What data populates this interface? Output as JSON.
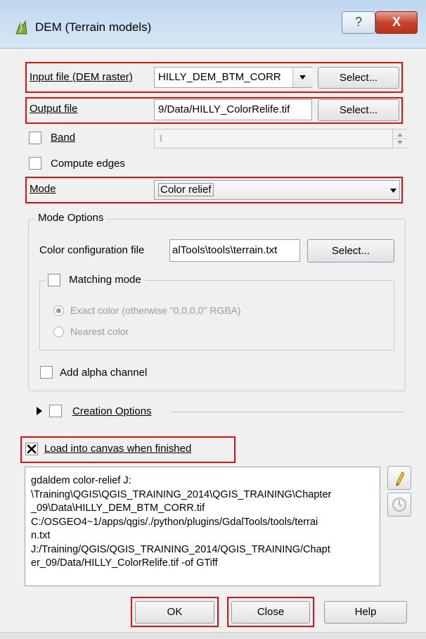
{
  "window": {
    "title": "DEM (Terrain models)",
    "help_glyph": "?",
    "close_glyph": "X"
  },
  "input": {
    "label": "Input file (DEM raster)",
    "value": "HILLY_DEM_BTM_CORR",
    "select_label": "Select..."
  },
  "output": {
    "label": "Output file",
    "value": "9/Data/HILLY_ColorRelife.tif",
    "select_label": "Select..."
  },
  "band": {
    "label": "Band",
    "value": "1",
    "checked": false
  },
  "compute_edges": {
    "label": "Compute edges",
    "checked": false
  },
  "mode": {
    "label": "Mode",
    "selected": "Color relief"
  },
  "mode_options": {
    "title": "Mode Options",
    "color_config_label": "Color configuration file",
    "color_config_value": "alTools\\tools\\terrain.txt",
    "select_label": "Select...",
    "matching_mode": {
      "label": "Matching mode",
      "checked": false,
      "exact_label": "Exact color (otherwise \"0,0,0,0\" RGBA)",
      "nearest_label": "Nearest color",
      "selected": "exact"
    },
    "alpha_label": "Add alpha channel"
  },
  "creation_options": {
    "label": "Creation Options",
    "expanded": false
  },
  "load_canvas": {
    "label": "Load into canvas when finished",
    "checked": true
  },
  "command": {
    "text": "gdaldem color-relief J:\n\\Training\\QGIS\\QGIS_TRAINING_2014\\QGIS_TRAINING\\Chapter\n_09\\Data\\HILLY_DEM_BTM_CORR.tif\nC:/OSGEO4~1/apps/qgis/./python/plugins/GdalTools/tools/terrai\nn.txt\nJ:/Training/QGIS/QGIS_TRAINING_2014/QGIS_TRAINING/Chapt\ner_09/Data/HILLY_ColorRelife.tif -of GTiff"
  },
  "buttons": {
    "ok": "OK",
    "close": "Close",
    "help": "Help"
  },
  "icons": {
    "title_icon": "dem-terrain-icon",
    "edit": "pencil-icon",
    "reset": "reset-icon"
  },
  "colors": {
    "highlight_red": "#e01010",
    "title_bar": "#c9def2",
    "close_red": "#c9432f"
  }
}
